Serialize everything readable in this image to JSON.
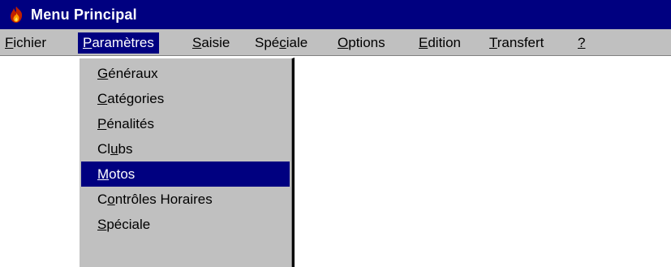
{
  "window": {
    "title": "Menu Principal",
    "icon": "flame-app-icon"
  },
  "menubar": {
    "items": [
      {
        "pre": "",
        "key": "F",
        "post": "ichier"
      },
      {
        "pre": "",
        "key": "P",
        "post": "aramètres",
        "active": true
      },
      {
        "pre": "",
        "key": "S",
        "post": "aisie"
      },
      {
        "pre": "Spé",
        "key": "c",
        "post": "iale"
      },
      {
        "pre": "",
        "key": "O",
        "post": "ptions"
      },
      {
        "pre": "",
        "key": "E",
        "post": "dition"
      },
      {
        "pre": "",
        "key": "T",
        "post": "ransfert"
      },
      {
        "pre": "",
        "key": "?",
        "post": ""
      }
    ]
  },
  "dropdown": {
    "items": [
      {
        "pre": "",
        "key": "G",
        "post": "énéraux"
      },
      {
        "pre": "",
        "key": "C",
        "post": "atégories"
      },
      {
        "pre": "",
        "key": "P",
        "post": "énalités"
      },
      {
        "pre": "Cl",
        "key": "u",
        "post": "bs"
      },
      {
        "pre": "",
        "key": "M",
        "post": "otos",
        "selected": true
      },
      {
        "pre": "C",
        "key": "o",
        "post": "ntrôles Horaires"
      },
      {
        "pre": "",
        "key": "S",
        "post": "péciale"
      }
    ]
  },
  "colors": {
    "titlebar": "#000080",
    "menu_background": "#c0c0c0",
    "highlight": "#000080",
    "highlight_text": "#ffffff"
  }
}
